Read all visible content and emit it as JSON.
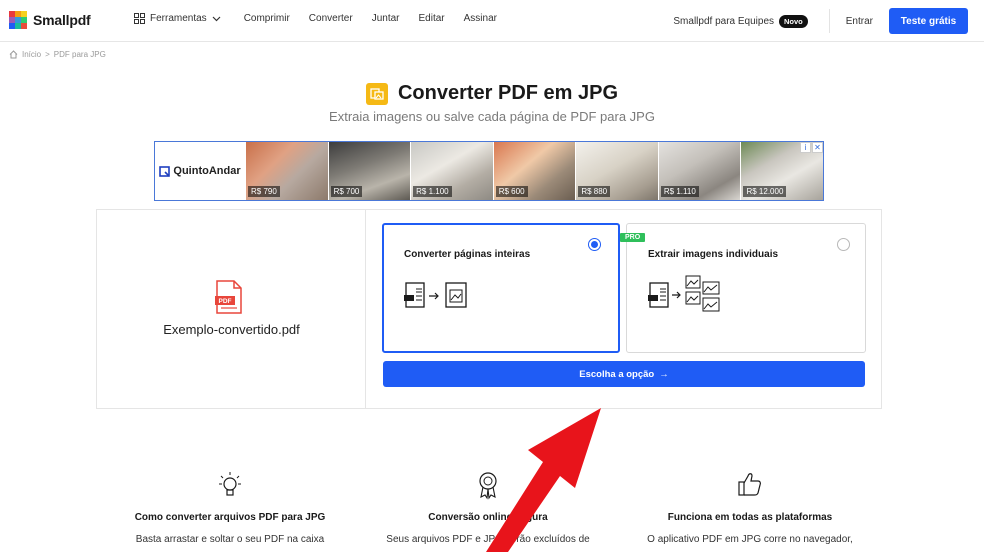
{
  "header": {
    "logo": "Smallpdf",
    "nav": {
      "tools": "Ferramentas",
      "compress": "Comprimir",
      "convert": "Converter",
      "merge": "Juntar",
      "edit": "Editar",
      "sign": "Assinar"
    },
    "teams": "Smallpdf para Equipes",
    "teams_badge": "Novo",
    "login": "Entrar",
    "trial": "Teste grátis"
  },
  "breadcrumb": {
    "home": "Início",
    "sep": ">",
    "current": "PDF para JPG"
  },
  "page": {
    "title": "Converter PDF em JPG",
    "subtitle": "Extraia imagens ou salve cada página de PDF para JPG"
  },
  "ad": {
    "brand": "QuintoAndar",
    "prices": [
      "R$ 790",
      "R$ 700",
      "R$ 1.100",
      "R$ 600",
      "R$ 880",
      "R$ 1.110",
      "R$ 12.000"
    ]
  },
  "converter": {
    "filename": "Exemplo-convertido.pdf",
    "pdf_label": "PDF",
    "option1": "Converter páginas inteiras",
    "option2": "Extrair imagens individuais",
    "pro": "PRO",
    "cta": "Escolha a opção",
    "cta_arrow": "→"
  },
  "features": [
    {
      "title": "Como converter arquivos PDF para JPG",
      "text": "Basta arrastar e soltar o seu PDF na caixa"
    },
    {
      "title": "Conversão online segura",
      "text": "Seus arquivos PDF e JPG serão excluídos de"
    },
    {
      "title": "Funciona em todas as plataformas",
      "text": "O aplicativo PDF em JPG corre no navegador,"
    }
  ],
  "colors": {
    "accent": "#1f5cf5",
    "title_icon": "#f5b915",
    "pro": "#2fbf5b",
    "annotation": "#e8141b"
  }
}
